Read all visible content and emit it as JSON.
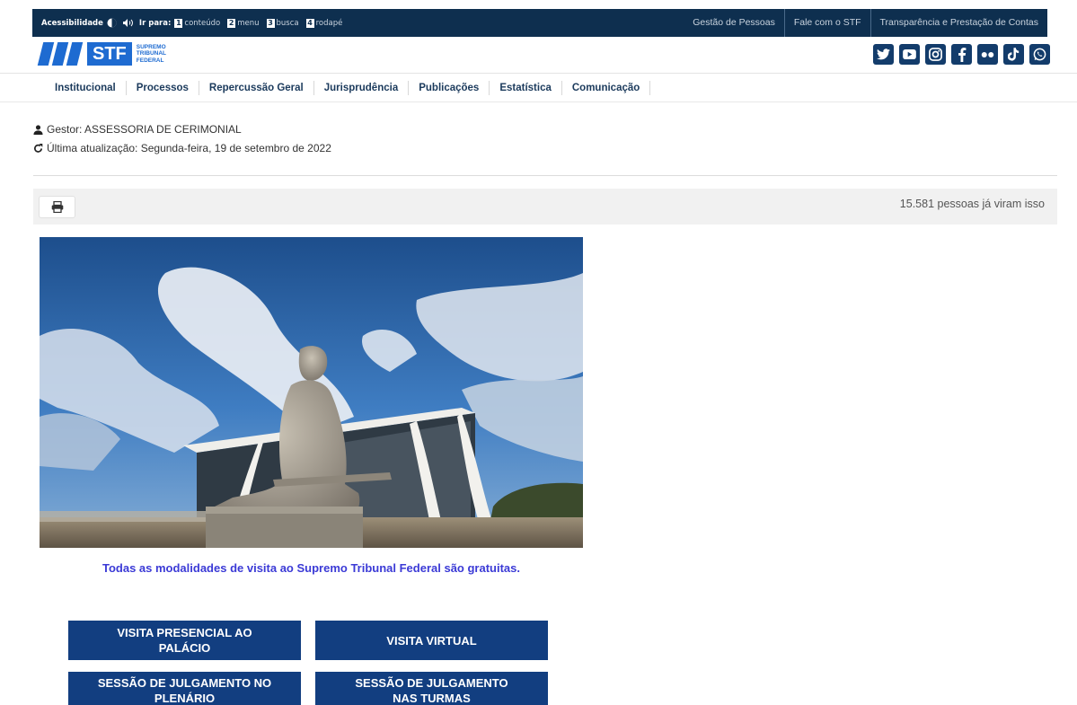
{
  "topbar": {
    "accessibility_label": "Acessibilidade",
    "goto_label": "Ir para:",
    "shortcuts": [
      {
        "key": "1",
        "label": "conteúdo"
      },
      {
        "key": "2",
        "label": "menu"
      },
      {
        "key": "3",
        "label": "busca"
      },
      {
        "key": "4",
        "label": "rodapé"
      }
    ],
    "links": [
      "Gestão de Pessoas",
      "Fale com o STF",
      "Transparência e Prestação de Contas"
    ]
  },
  "logo": {
    "name": "STF",
    "subtitle": [
      "SUPREMO",
      "TRIBUNAL",
      "FEDERAL"
    ]
  },
  "social": [
    "twitter-icon",
    "youtube-icon",
    "instagram-icon",
    "facebook-icon",
    "flickr-icon",
    "tiktok-icon",
    "whatsapp-icon"
  ],
  "nav": [
    "Institucional",
    "Processos",
    "Repercussão Geral",
    "Jurisprudência",
    "Publicações",
    "Estatística",
    "Comunicação"
  ],
  "meta": {
    "manager": "Gestor: ASSESSORIA DE CERIMONIAL",
    "updated": "Última atualização: Segunda-feira, 19 de setembro de 2022"
  },
  "toolbar": {
    "views": "15.581 pessoas já viram isso"
  },
  "caption": "Todas as modalidades de visita ao Supremo Tribunal Federal são gratuitas.",
  "buttons": [
    "VISITA PRESENCIAL AO PALÁCIO",
    "VISITA VIRTUAL",
    "SESSÃO DE JULGAMENTO NO PLENÁRIO",
    "SESSÃO DE JULGAMENTO NAS TURMAS"
  ],
  "colors": {
    "topbar": "#0e2f4f",
    "brand_blue": "#1e6bd1",
    "button_blue": "#123e80",
    "caption_blue": "#3b3ad6"
  }
}
